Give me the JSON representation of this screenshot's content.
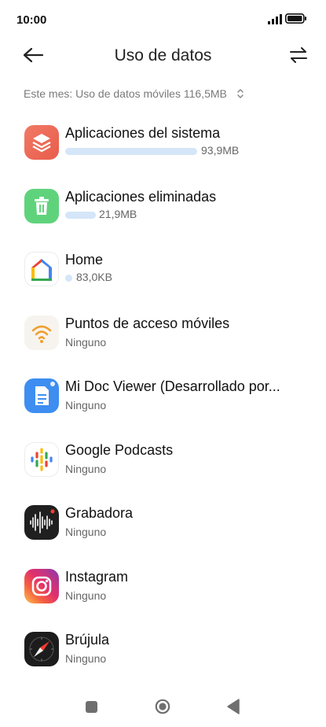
{
  "status": {
    "time": "10:00"
  },
  "header": {
    "title": "Uso de datos"
  },
  "summary": {
    "text": "Este mes: Uso de datos móviles 116,5MB",
    "chevron": "⌃⌄"
  },
  "apps": [
    {
      "name": "Aplicaciones del sistema",
      "usage": "93,9MB",
      "usage_fraction": 0.806,
      "icon": "layers-icon"
    },
    {
      "name": "Aplicaciones eliminadas",
      "usage": "21,9MB",
      "usage_fraction": 0.188,
      "icon": "trash-icon"
    },
    {
      "name": "Home",
      "usage": "83,0KB",
      "usage_fraction": 0.0007,
      "icon": "google-home-icon"
    },
    {
      "name": "Puntos de acceso móviles",
      "usage": "Ninguno",
      "icon": "wifi-hotspot-icon"
    },
    {
      "name": "Mi Doc Viewer (Desarrollado por...",
      "usage": "Ninguno",
      "icon": "document-icon"
    },
    {
      "name": "Google Podcasts",
      "usage": "Ninguno",
      "icon": "podcasts-icon"
    },
    {
      "name": "Grabadora",
      "usage": "Ninguno",
      "icon": "recorder-icon"
    },
    {
      "name": "Instagram",
      "usage": "Ninguno",
      "icon": "instagram-icon"
    },
    {
      "name": "Brújula",
      "usage": "Ninguno",
      "icon": "compass-icon"
    }
  ],
  "colors": {
    "bar": "#d4e6f8",
    "accent_orange": "#f0a030"
  }
}
